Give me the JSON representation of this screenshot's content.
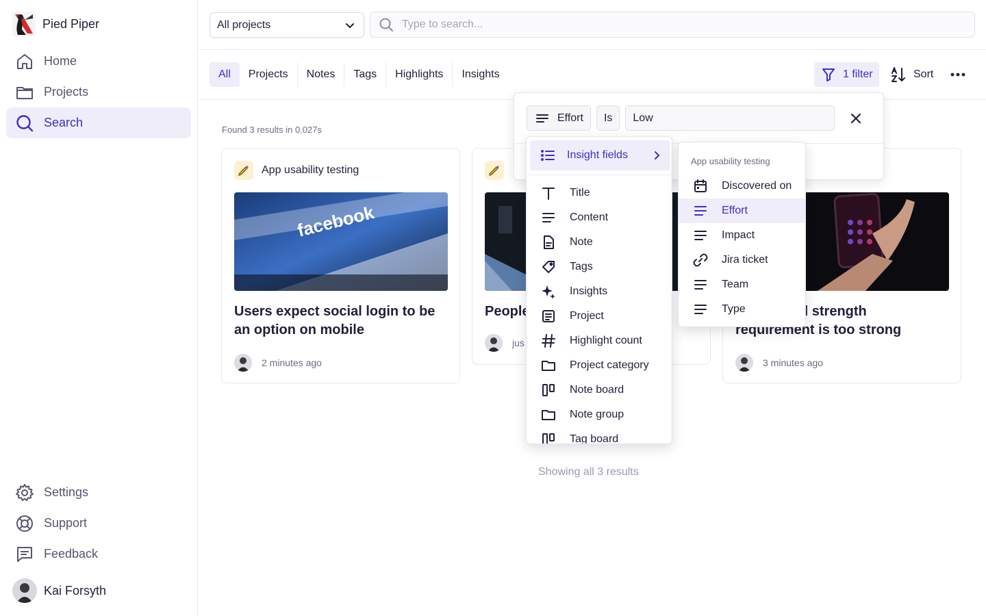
{
  "sidebar": {
    "brand": "Pied Piper",
    "nav_top": [
      {
        "label": "Home",
        "icon": "home-icon"
      },
      {
        "label": "Projects",
        "icon": "folder-icon"
      },
      {
        "label": "Search",
        "icon": "search-icon",
        "active": true
      }
    ],
    "nav_bottom": [
      {
        "label": "Settings",
        "icon": "gear-icon"
      },
      {
        "label": "Support",
        "icon": "lifebuoy-icon"
      },
      {
        "label": "Feedback",
        "icon": "feedback-icon"
      }
    ],
    "user_name": "Kai Forsyth"
  },
  "topbar": {
    "project_select": "All projects",
    "search_placeholder": "Type to search..."
  },
  "tabs": [
    "All",
    "Projects",
    "Notes",
    "Tags",
    "Highlights",
    "Insights"
  ],
  "toolbar": {
    "filter_label": "1 filter",
    "sort_label": "Sort"
  },
  "results": {
    "summary": "Found 3 results in 0.027s",
    "showing": "Showing all 3 results",
    "cards": [
      {
        "project": "App usability testing",
        "title": "Users expect social login to be an option on mobile",
        "time": "2 minutes ago"
      },
      {
        "project": "",
        "title": "People",
        "time": "jus"
      },
      {
        "project": "",
        "title": "ord strength requirement is too strong",
        "title_line1": "ord strength",
        "title_line2": "requirement is too strong",
        "time": "3 minutes ago"
      }
    ]
  },
  "filter": {
    "field": "Effort",
    "operator": "Is",
    "value": "Low"
  },
  "field_menu": {
    "group_label": "Insight fields",
    "items": [
      "Title",
      "Content",
      "Note",
      "Tags",
      "Insights",
      "Project",
      "Highlight count",
      "Project category",
      "Note board",
      "Note group",
      "Tag board"
    ]
  },
  "sub_menu": {
    "header": "App usability testing",
    "items": [
      "Discovered on",
      "Effort",
      "Impact",
      "Jira ticket",
      "Team",
      "Type"
    ],
    "selected": "Effort"
  },
  "colors": {
    "accent": "#3b2fc9",
    "accent_bg": "#efedfa",
    "text": "#1f1f3a",
    "muted": "#6c6c80"
  }
}
